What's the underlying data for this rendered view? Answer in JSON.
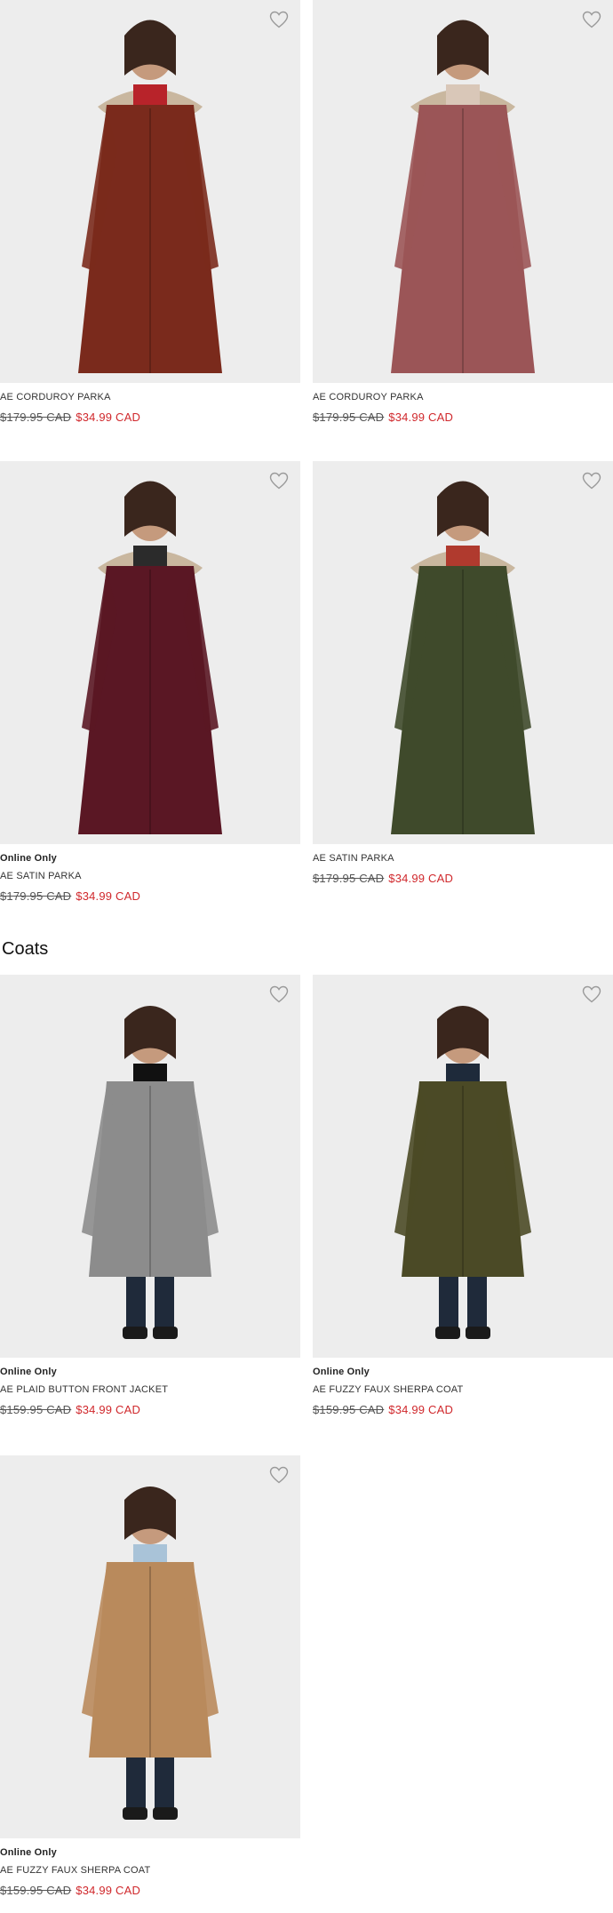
{
  "products_top": [
    {
      "badge": "",
      "name": "AE CORDUROY PARKA",
      "was": "$179.95 CAD",
      "now": "$34.99 CAD",
      "coat": "#7a2a1c",
      "accent": "#b8232a",
      "bg": "#ededed"
    },
    {
      "badge": "",
      "name": "AE CORDUROY PARKA",
      "was": "$179.95 CAD",
      "now": "$34.99 CAD",
      "coat": "#9b5557",
      "accent": "#d9c7b8",
      "bg": "#ededed"
    },
    {
      "badge": "Online Only",
      "name": "AE SATIN PARKA",
      "was": "$179.95 CAD",
      "now": "$34.99 CAD",
      "coat": "#5a1724",
      "accent": "#2b2b2b",
      "bg": "#ededed"
    },
    {
      "badge": "",
      "name": "AE SATIN PARKA",
      "was": "$179.95 CAD",
      "now": "$34.99 CAD",
      "coat": "#3f4a2b",
      "accent": "#b03a2e",
      "bg": "#ededed"
    }
  ],
  "coats_section": {
    "title": "Coats"
  },
  "products_coats": [
    {
      "badge": "Online Only",
      "name": "AE PLAID BUTTON FRONT JACKET",
      "was": "$159.95 CAD",
      "now": "$34.99 CAD",
      "coat": "#8c8c8c",
      "accent": "#111111",
      "bg": "#ededed"
    },
    {
      "badge": "Online Only",
      "name": "AE FUZZY FAUX SHERPA COAT",
      "was": "$159.95 CAD",
      "now": "$34.99 CAD",
      "coat": "#4b4a26",
      "accent": "#1e2a3a",
      "bg": "#ededed"
    },
    {
      "badge": "Online Only",
      "name": "AE FUZZY FAUX SHERPA COAT",
      "was": "$159.95 CAD",
      "now": "$34.99 CAD",
      "coat": "#b98a5c",
      "accent": "#a9c3d8",
      "bg": "#ededed"
    }
  ],
  "icons": {
    "favorite": "heart-outline-icon"
  }
}
